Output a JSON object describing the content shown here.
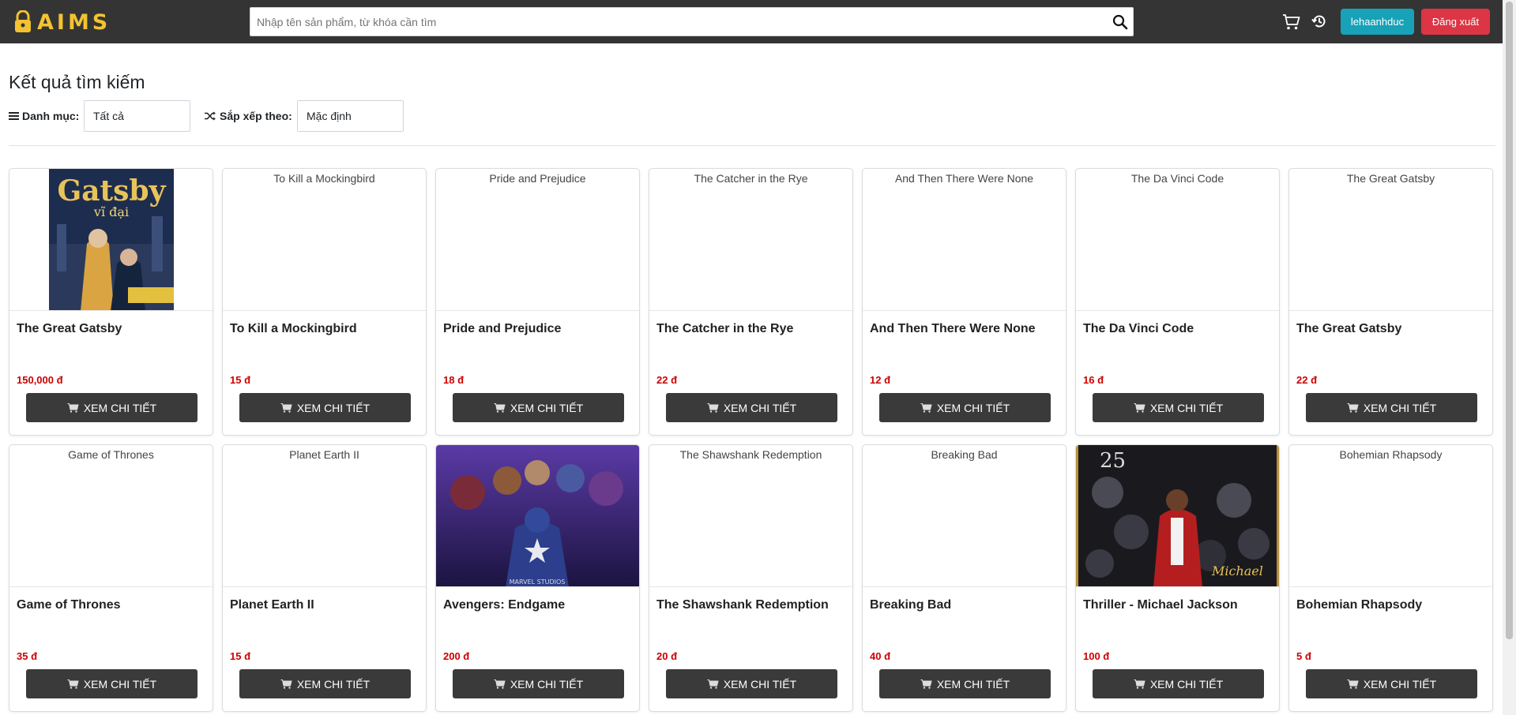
{
  "header": {
    "logo_text": "AIMS",
    "search_placeholder": "Nhập tên sản phẩm, từ khóa cần tìm",
    "user_label": "lehaanhduc",
    "logout_label": "Đăng xuất"
  },
  "page": {
    "title": "Kết quả tìm kiếm",
    "category_label": "Danh mục:",
    "category_value": "Tất cả",
    "sort_label": "Sắp xếp theo:",
    "sort_value": "Mặc định"
  },
  "products": [
    {
      "title": "The Great Gatsby",
      "price": "150,000 đ",
      "alt": "",
      "image": "gatsby-cover",
      "button": "XEM CHI TIẾT"
    },
    {
      "title": "To Kill a Mockingbird",
      "price": "15 đ",
      "alt": "To Kill a Mockingbird",
      "image": "",
      "button": "XEM CHI TIẾT"
    },
    {
      "title": "Pride and Prejudice",
      "price": "18 đ",
      "alt": "Pride and Prejudice",
      "image": "",
      "button": "XEM CHI TIẾT"
    },
    {
      "title": "The Catcher in the Rye",
      "price": "22 đ",
      "alt": "The Catcher in the Rye",
      "image": "",
      "button": "XEM CHI TIẾT"
    },
    {
      "title": "And Then There Were None",
      "price": "12 đ",
      "alt": "And Then There Were None",
      "image": "",
      "button": "XEM CHI TIẾT"
    },
    {
      "title": "The Da Vinci Code",
      "price": "16 đ",
      "alt": "The Da Vinci Code",
      "image": "",
      "button": "XEM CHI TIẾT"
    },
    {
      "title": "The Great Gatsby",
      "price": "22 đ",
      "alt": "The Great Gatsby",
      "image": "",
      "button": "XEM CHI TIẾT"
    },
    {
      "title": "Game of Thrones",
      "price": "35 đ",
      "alt": "Game of Thrones",
      "image": "",
      "button": "XEM CHI TIẾT"
    },
    {
      "title": "Planet Earth II",
      "price": "15 đ",
      "alt": "Planet Earth II",
      "image": "",
      "button": "XEM CHI TIẾT"
    },
    {
      "title": "Avengers: Endgame",
      "price": "200 đ",
      "alt": "",
      "image": "avengers-poster",
      "button": "XEM CHI TIẾT"
    },
    {
      "title": "The Shawshank Redemption",
      "price": "20 đ",
      "alt": "The Shawshank Redemption",
      "image": "",
      "button": "XEM CHI TIẾT"
    },
    {
      "title": "Breaking Bad",
      "price": "40 đ",
      "alt": "Breaking Bad",
      "image": "",
      "button": "XEM CHI TIẾT"
    },
    {
      "title": "Thriller - Michael Jackson",
      "price": "100 đ",
      "alt": "",
      "image": "thriller-cover",
      "button": "XEM CHI TIẾT"
    },
    {
      "title": "Bohemian Rhapsody",
      "price": "5 đ",
      "alt": "Bohemian Rhapsody",
      "image": "",
      "button": "XEM CHI TIẾT"
    }
  ],
  "colors": {
    "header_bg": "#343434",
    "logo": "#f2c230",
    "user_button": "#17a2b8",
    "logout_button": "#dc3545",
    "price": "#cc0000",
    "detail_button": "#3a3a3a"
  }
}
